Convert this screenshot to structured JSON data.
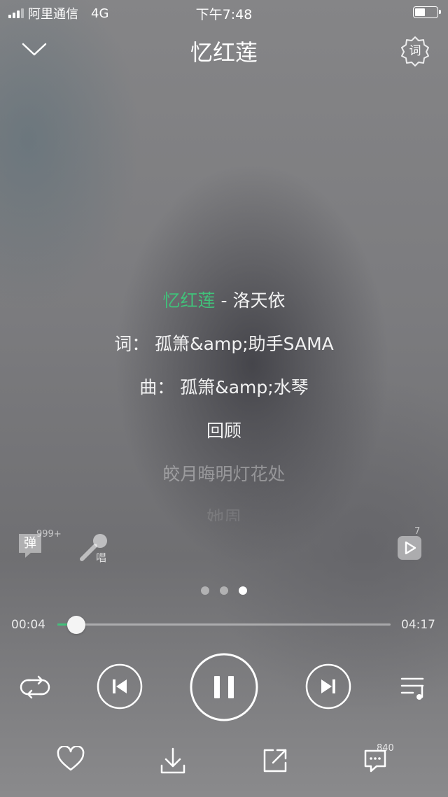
{
  "status_bar": {
    "carrier": "阿里通信",
    "network": "4G",
    "time": "下午7:48",
    "battery_level": 0.45
  },
  "header": {
    "title": "忆红莲",
    "collapse_icon": "chevron-down-icon",
    "lyrics_settings_icon": "lyrics-settings-icon",
    "lyrics_settings_glyph": "词"
  },
  "lyrics": {
    "song_title": "忆红莲",
    "song_artist": " - 洛天依",
    "lines": [
      "词：  孤箫&amp;助手SAMA",
      "曲：  孤箫&amp;水琴",
      "回顾",
      "皎月晦明灯花处",
      "她周"
    ]
  },
  "action_row": {
    "danmu_glyph": "弹",
    "danmu_count": "999+",
    "sing_glyph": "唱",
    "video_count": "7"
  },
  "page_indicator": {
    "count": 3,
    "active_index": 2
  },
  "progress": {
    "elapsed": "00:04",
    "total": "04:17",
    "fraction": 0.016
  },
  "controls": {
    "repeat_icon": "repeat-icon",
    "prev_icon": "previous-icon",
    "play_pause_icon": "pause-icon",
    "next_icon": "next-icon",
    "playlist_icon": "playlist-icon"
  },
  "bottom_row": {
    "like_icon": "heart-icon",
    "download_icon": "download-icon",
    "share_icon": "share-icon",
    "comment_icon": "comment-icon",
    "comment_count": "840"
  },
  "colors": {
    "accent": "#41c17a"
  }
}
